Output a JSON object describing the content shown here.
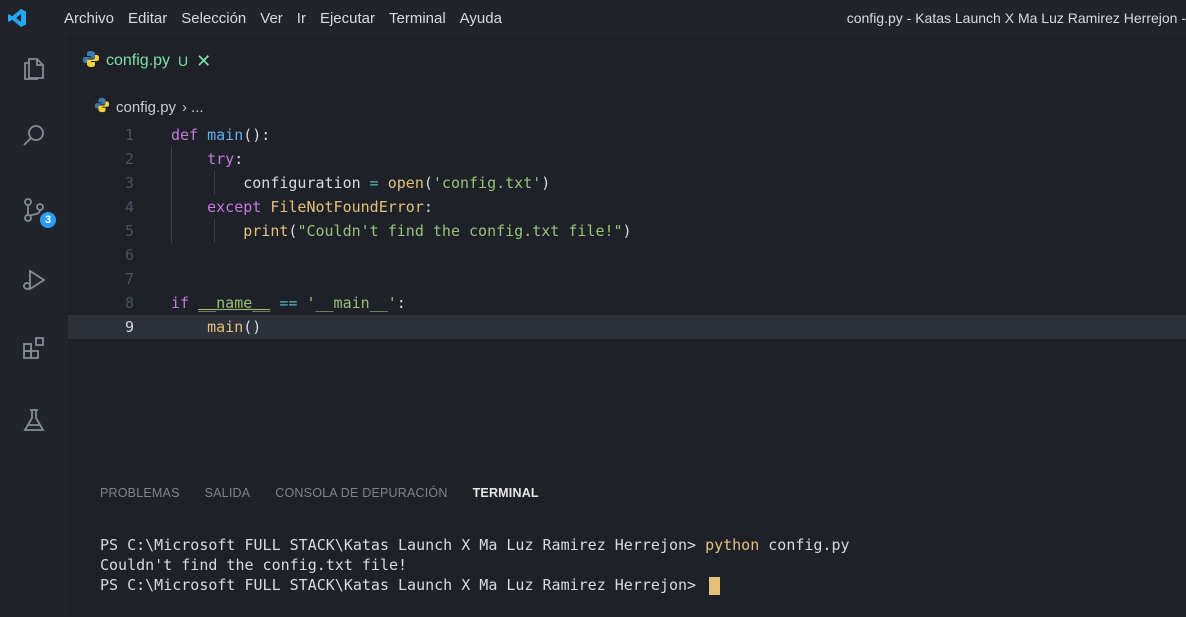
{
  "menu": {
    "items": [
      "Archivo",
      "Editar",
      "Selección",
      "Ver",
      "Ir",
      "Ejecutar",
      "Terminal",
      "Ayuda"
    ]
  },
  "window_title": "config.py - Katas Launch X Ma Luz Ramirez Herrejon -",
  "activity": {
    "icons": [
      "explorer-icon",
      "search-icon",
      "source-control-icon",
      "run-debug-icon",
      "extensions-icon",
      "testing-icon"
    ],
    "scm_badge": "3",
    "badge_color": "#2a9df4"
  },
  "tab": {
    "name": "config.py",
    "status": "U",
    "close": "✕",
    "color": "#7ee0a6"
  },
  "breadcrumb": {
    "file": "config.py",
    "sep": "›",
    "ellipsis": "..."
  },
  "code": {
    "line_numbers": [
      "1",
      "2",
      "3",
      "4",
      "5",
      "6",
      "7",
      "8",
      "9"
    ],
    "l1": {
      "kw": "def",
      "fn": "main",
      "punc": "():"
    },
    "l2": {
      "kw": "try",
      "punc": ":"
    },
    "l3": {
      "var": "configuration",
      "op": " = ",
      "fn": "open",
      "p1": "(",
      "str": "'config.txt'",
      "p2": ")"
    },
    "l4": {
      "kw": "except",
      "cls": "FileNotFoundError",
      "punc": ":"
    },
    "l5": {
      "fn": "print",
      "p1": "(",
      "str": "\"Couldn't find the config.txt file!\"",
      "p2": ")"
    },
    "l8": {
      "kw": "if",
      "d1": "__name__",
      "op": " == ",
      "str": "'__main__'",
      "punc": ":"
    },
    "l9": {
      "fn": "main",
      "punc": "()"
    }
  },
  "panel": {
    "tabs": [
      "PROBLEMAS",
      "SALIDA",
      "CONSOLA DE DEPURACIÓN",
      "TERMINAL"
    ],
    "active_tab": "TERMINAL"
  },
  "terminal": {
    "prompt1": "PS C:\\Microsoft FULL STACK\\Katas Launch X Ma Luz Ramirez Herrejon> ",
    "cmd1": "python",
    "args1": " config.py",
    "output1": "Couldn't find the config.txt file!",
    "prompt2": "PS C:\\Microsoft FULL STACK\\Katas Launch X Ma Luz Ramirez Herrejon> "
  }
}
